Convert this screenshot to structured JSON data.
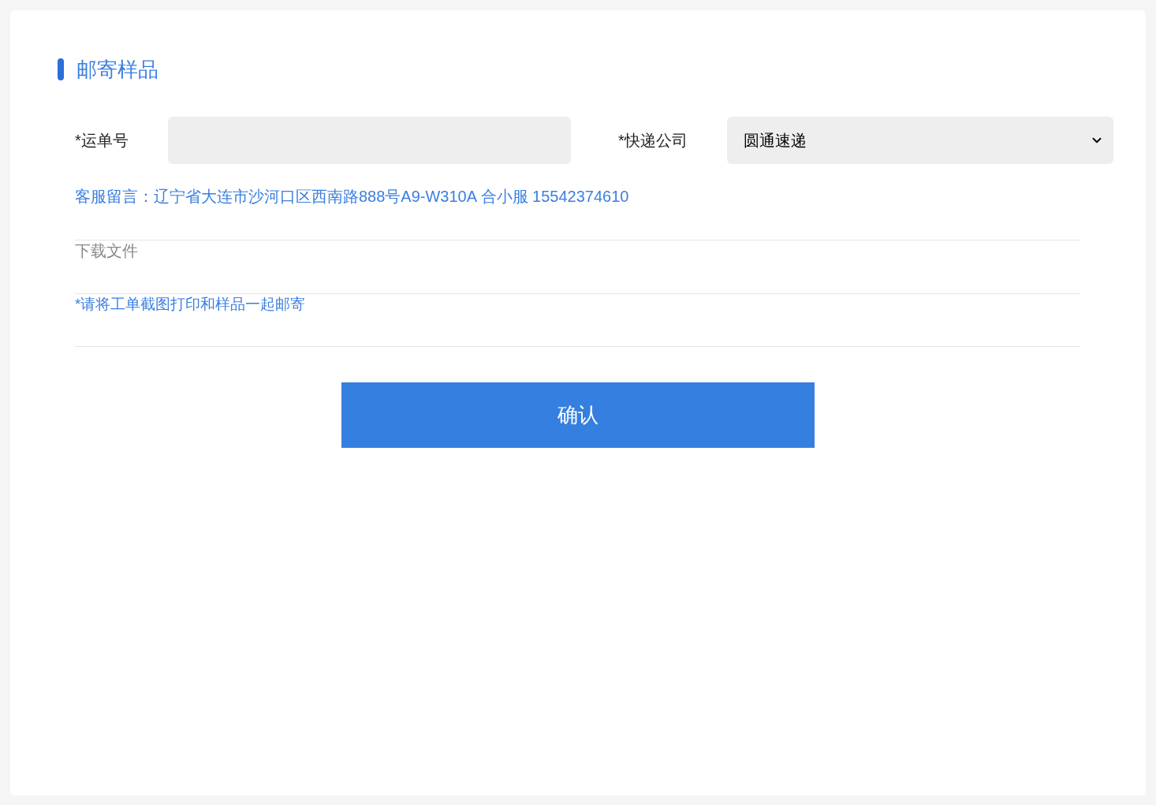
{
  "title": "邮寄样品",
  "fields": [
    {
      "label": "*运单号"
    },
    {
      "label": "*快递公司",
      "value": "圆通速递"
    }
  ],
  "message": "客服留言：辽宁省大连市沙河口区西南路888号A9-W310A 合小服 15542374610",
  "download": "下载文件",
  "notice": "*请将工单截图打印和样品一起邮寄",
  "confirm_button": "确认"
}
